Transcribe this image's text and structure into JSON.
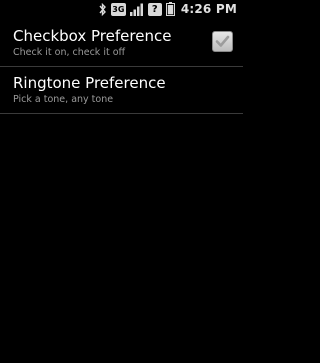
{
  "status_bar": {
    "network_label": "3G",
    "alert_label": "?",
    "time": "4:26 PM"
  },
  "preferences": [
    {
      "title": "Checkbox Preference",
      "summary": "Check it on, check it off",
      "checked": true
    },
    {
      "title": "Ringtone Preference",
      "summary": "Pick a tone, any tone"
    }
  ],
  "colors": {
    "background": "#000000",
    "title_text": "#ffffff",
    "summary_text": "#9a9a9a",
    "divider": "#3a3a3a"
  }
}
